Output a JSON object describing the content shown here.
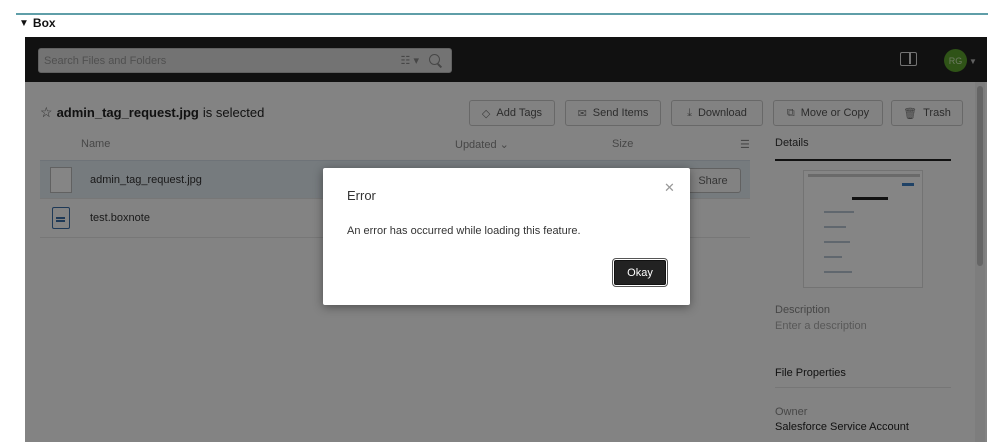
{
  "section": {
    "title": "Box"
  },
  "header": {
    "search_placeholder": "Search Files and Folders",
    "avatar_initials": "RG"
  },
  "selection": {
    "filename": "admin_tag_request.jpg",
    "suffix": "is selected"
  },
  "toolbar": {
    "add_tags": "Add Tags",
    "send_items": "Send Items",
    "download": "Download",
    "move_or_copy": "Move or Copy",
    "trash": "Trash"
  },
  "list": {
    "columns": {
      "name": "Name",
      "updated": "Updated",
      "size": "Size"
    },
    "rows": [
      {
        "name": "admin_tag_request.jpg",
        "selected": true
      },
      {
        "name": "test.boxnote",
        "selected": false
      }
    ],
    "share_label": "Share"
  },
  "details": {
    "tab": "Details",
    "description_label": "Description",
    "description_placeholder": "Enter a description",
    "file_properties": "File Properties",
    "owner_label": "Owner",
    "owner_value": "Salesforce Service Account"
  },
  "modal": {
    "title": "Error",
    "message": "An error has occurred while loading this feature.",
    "ok_label": "Okay"
  },
  "colors": {
    "accent_rule": "#5f9ea8",
    "avatar": "#5aa02c",
    "topbar": "#222222"
  }
}
